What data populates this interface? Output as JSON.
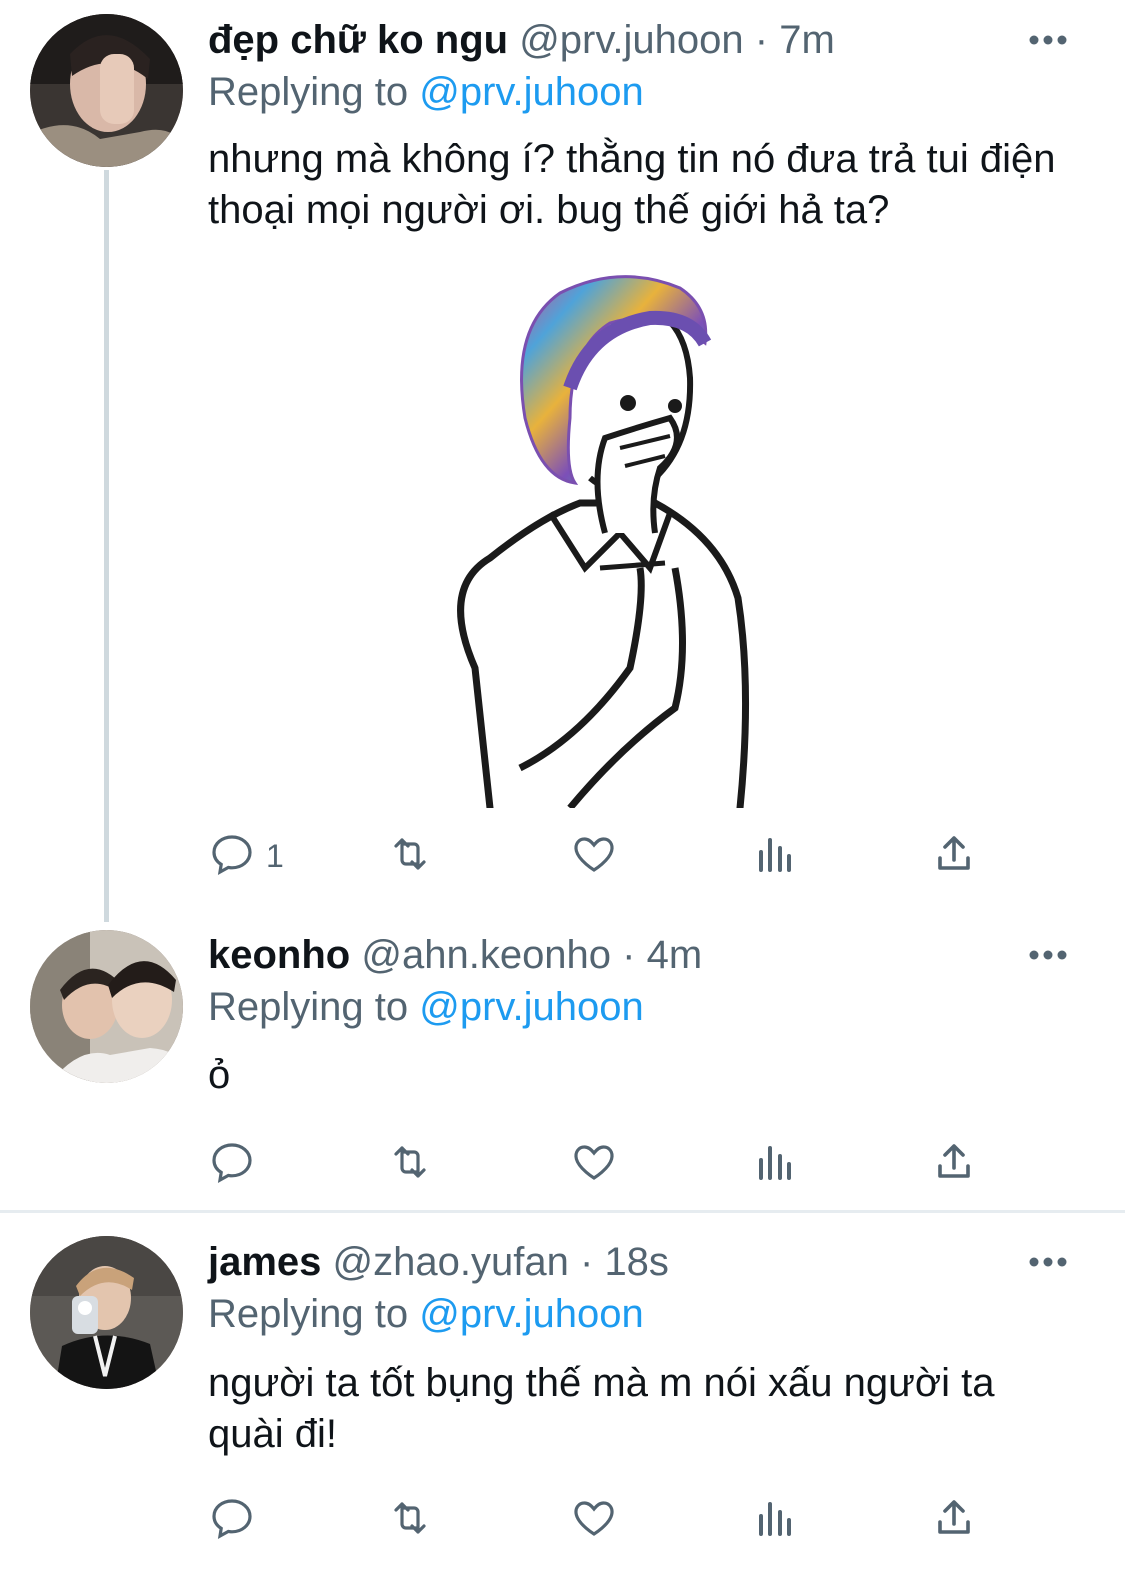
{
  "tweets": [
    {
      "display_name": "đẹp chữ ko ngu",
      "handle": "@prv.juhoon",
      "time": "7m",
      "replying_label": "Replying to",
      "replying_to": "@prv.juhoon",
      "text": "nhưng mà không í? thằng tin nó đưa trả tui điện thoại mọi người ơi. bug thế giới hả ta?",
      "reply_count": "1",
      "has_media": true
    },
    {
      "display_name": "keonho",
      "handle": "@ahn.keonho",
      "time": "4m",
      "replying_label": "Replying to",
      "replying_to": "@prv.juhoon",
      "text": "ỏ",
      "reply_count": ""
    },
    {
      "display_name": "james",
      "handle": "@zhao.yufan",
      "time": "18s",
      "replying_label": "Replying to",
      "replying_to": "@prv.juhoon",
      "text": "người ta tốt bụng thế mà m nói xấu người ta quài đi!",
      "reply_count": ""
    }
  ],
  "icons": {
    "reply": "reply-icon",
    "retweet": "retweet-icon",
    "like": "heart-icon",
    "views": "analytics-icon",
    "share": "share-icon",
    "more": "more-icon"
  },
  "colors": {
    "link": "#1d9bf0",
    "secondary_text": "#536471",
    "thread_line": "#cfd9de"
  }
}
